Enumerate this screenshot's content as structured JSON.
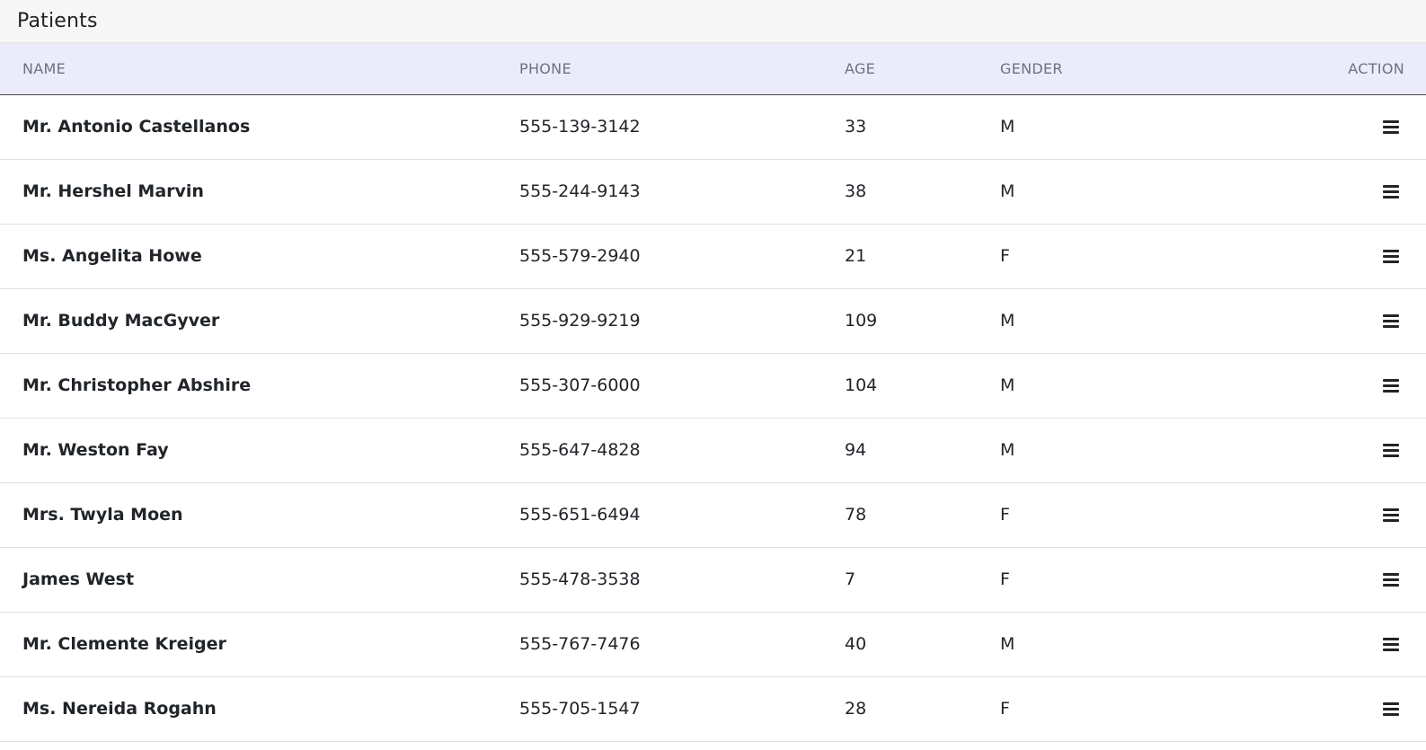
{
  "panel": {
    "title": "Patients"
  },
  "table": {
    "headers": {
      "name": "NAME",
      "phone": "PHONE",
      "age": "AGE",
      "gender": "GENDER",
      "action": "ACTION"
    },
    "rows": [
      {
        "name": "Mr. Antonio Castellanos",
        "phone": "555-139-3142",
        "age": "33",
        "gender": "M",
        "action_icon": "hamburger-menu-icon"
      },
      {
        "name": "Mr. Hershel Marvin",
        "phone": "555-244-9143",
        "age": "38",
        "gender": "M",
        "action_icon": "hamburger-menu-icon"
      },
      {
        "name": "Ms. Angelita Howe",
        "phone": "555-579-2940",
        "age": "21",
        "gender": "F",
        "action_icon": "hamburger-menu-icon"
      },
      {
        "name": "Mr. Buddy MacGyver",
        "phone": "555-929-9219",
        "age": "109",
        "gender": "M",
        "action_icon": "hamburger-menu-icon"
      },
      {
        "name": "Mr. Christopher Abshire",
        "phone": "555-307-6000",
        "age": "104",
        "gender": "M",
        "action_icon": "hamburger-menu-icon"
      },
      {
        "name": "Mr. Weston Fay",
        "phone": "555-647-4828",
        "age": "94",
        "gender": "M",
        "action_icon": "hamburger-menu-icon"
      },
      {
        "name": "Mrs. Twyla Moen",
        "phone": "555-651-6494",
        "age": "78",
        "gender": "F",
        "action_icon": "hamburger-menu-icon"
      },
      {
        "name": "James West",
        "phone": "555-478-3538",
        "age": "7",
        "gender": "F",
        "action_icon": "hamburger-menu-icon"
      },
      {
        "name": "Mr. Clemente Kreiger",
        "phone": "555-767-7476",
        "age": "40",
        "gender": "M",
        "action_icon": "hamburger-menu-icon"
      },
      {
        "name": "Ms. Nereida Rogahn",
        "phone": "555-705-1547",
        "age": "28",
        "gender": "F",
        "action_icon": "hamburger-menu-icon"
      }
    ]
  },
  "colors": {
    "header_bg": "#ecebfb",
    "panel_header_bg": "#f7f7f7",
    "header_text": "#6b7280",
    "body_text": "#212529"
  }
}
